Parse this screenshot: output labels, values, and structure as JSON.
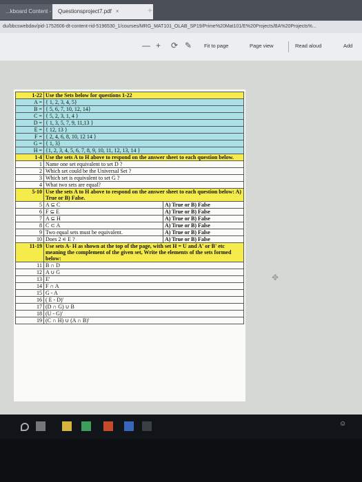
{
  "browser": {
    "tab1": "...kboard Content - B",
    "tab2": "Questionsproject7.pdf",
    "tab_close": "×",
    "new_tab": "+",
    "url": "du/bbcswebdav/pid-1752606-dt-content-rid-5196530_1/courses/MRG_MAT101_OLAB_SP19/Prime%20Mat101/E%20Projects/BA%20Projects%..."
  },
  "toolbar": {
    "minus": "—",
    "plus": "+",
    "rotate": "⟳",
    "draw": "✎",
    "fit": "Fit to page",
    "page_view": "Page view",
    "read_aloud": "Read aloud",
    "add": "Add"
  },
  "rows": [
    {
      "num": "1-22",
      "text": "Use the Sets below  for questions 1-22",
      "color": "yellow",
      "bold": true,
      "ans": ""
    },
    {
      "num": "A =",
      "text": "{ 1, 2, 3, 4, 5}",
      "color": "cyan",
      "ans": ""
    },
    {
      "num": "B =",
      "text": "{ 5, 6, 7, 10, 12, 14}",
      "color": "cyan",
      "ans": ""
    },
    {
      "num": "C =",
      "text": "{ 5, 2, 3, 1, 4 }",
      "color": "cyan",
      "ans": ""
    },
    {
      "num": "D =",
      "text": "{ 1,  3, 5, 7, 9, 11,13 }",
      "color": "cyan",
      "ans": ""
    },
    {
      "num": "E =",
      "text": "{ 12, 13 }",
      "color": "cyan",
      "ans": ""
    },
    {
      "num": "F =",
      "text": "{ 2, 4, 6, 8, 10, 12 14 }",
      "color": "cyan",
      "ans": ""
    },
    {
      "num": "G =",
      "text": "{ 1, 3}",
      "color": "cyan",
      "ans": ""
    },
    {
      "num": "H =",
      "text": "{1, 2, 3, 4,  5, 6, 7, 8, 9, 10, 11, 12, 13, 14 }",
      "color": "cyan",
      "ans": ""
    },
    {
      "num": "1-4",
      "text": "Use the sets A to H above to respond on the answer sheet to each question below.",
      "color": "yellow",
      "bold": true,
      "ans": ""
    },
    {
      "num": "1",
      "text": "Name one set equivalent to set     D ?",
      "color": "white",
      "ans": ""
    },
    {
      "num": "2",
      "text": "Which set could be the Universal Set ?",
      "color": "white",
      "ans": ""
    },
    {
      "num": "3",
      "text": "Which set is equivalent to set   G ?",
      "color": "white",
      "ans": ""
    },
    {
      "num": "4",
      "text": "What two sets are equal?",
      "color": "white",
      "ans": ""
    },
    {
      "num": "5-10",
      "text": "Use the sets A to H above to respond on the answer sheet to each question below:          A) True  or   B)  False.",
      "color": "yellow",
      "bold": true,
      "ans": ""
    },
    {
      "num": "5",
      "text": "A ⊆ C",
      "color": "white",
      "ans": "A) True   or   B)  False"
    },
    {
      "num": "6",
      "text": "F ⊆ E",
      "color": "white",
      "ans": "A) True   or   B)  False"
    },
    {
      "num": "7",
      "text": "A   ⊆   H",
      "color": "white",
      "ans": "A) True   or   B)  False"
    },
    {
      "num": "8",
      "text": "C   ⊂ A",
      "color": "white",
      "ans": "A) True   or   B)  False"
    },
    {
      "num": "9",
      "text": "Two equal  sets must be equivalent.",
      "color": "white",
      "ans": "A) True   or   B)  False"
    },
    {
      "num": "10",
      "text": "Does    2  ∊  E ?",
      "color": "white",
      "ans": "A) True   or   B)  False"
    },
    {
      "num": "11-19",
      "text": "Use sets A- H as shown at the top of the page, with set H = U and A' or B' etc meaning the complement of the given set,  Write the elements of the sets formed below:",
      "color": "yellow",
      "bold": true,
      "ans": ""
    },
    {
      "num": "11",
      "text": "B   ∩ D",
      "color": "white",
      "ans": ""
    },
    {
      "num": "12",
      "text": "A      ∪ G",
      "color": "white",
      "ans": ""
    },
    {
      "num": "13",
      "text": "E'",
      "color": "white",
      "ans": ""
    },
    {
      "num": "14",
      "text": "F ∩   A",
      "color": "white",
      "ans": ""
    },
    {
      "num": "15",
      "text": "G - A",
      "color": "white",
      "ans": ""
    },
    {
      "num": "16",
      "text": "( E - D)'",
      "color": "white",
      "ans": ""
    },
    {
      "num": "17",
      "text": "(D ∩ G)  ∪   B",
      "color": "white",
      "ans": ""
    },
    {
      "num": "18",
      "text": "(U - G)'",
      "color": "white",
      "ans": ""
    },
    {
      "num": "19",
      "text": "(C ∩ H)  ∪  (A ∩  B)'",
      "color": "white",
      "ans": ""
    }
  ]
}
